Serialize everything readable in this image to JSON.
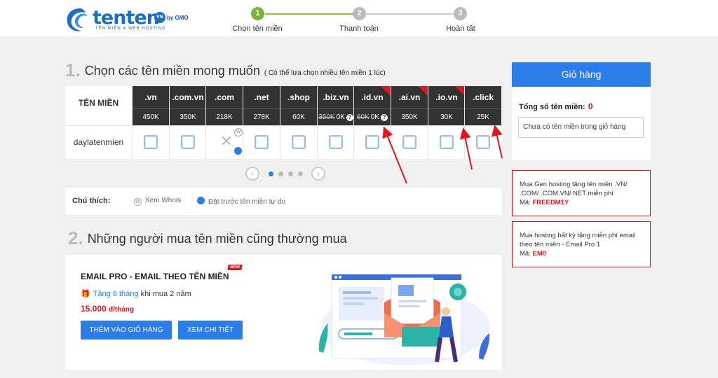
{
  "logo": {
    "brand": "tenten",
    "vn_badge": "VN",
    "gmo": "by GMO",
    "tagline": "TÊN MIỀN & WEB HOSTING"
  },
  "steps": [
    {
      "num": "1",
      "label": "Chọn tên miền",
      "active": true
    },
    {
      "num": "2",
      "label": "Thanh toán",
      "active": false
    },
    {
      "num": "3",
      "label": "Hoàn tất",
      "active": false
    }
  ],
  "section1": {
    "num": "1.",
    "title": "Chọn các tên miền mong muốn",
    "note": "( Có thể lựa chọn nhiều tên miền 1 lúc)"
  },
  "domain_table": {
    "header_label": "TÊN MIỀN",
    "domain_name": "daylatenmien",
    "extensions": [
      {
        "ext": ".vn",
        "price": "450K",
        "old_price": "",
        "new": false,
        "available": true
      },
      {
        "ext": ".com.vn",
        "price": "350K",
        "old_price": "",
        "new": false,
        "available": true
      },
      {
        "ext": ".com",
        "price": "218K",
        "old_price": "",
        "new": false,
        "available": false
      },
      {
        "ext": ".net",
        "price": "278K",
        "old_price": "",
        "new": false,
        "available": true
      },
      {
        "ext": ".shop",
        "price": "60K",
        "old_price": "",
        "new": false,
        "available": true
      },
      {
        "ext": ".biz.vn",
        "price": "0K",
        "old_price": "350K",
        "new": false,
        "available": true
      },
      {
        "ext": ".id.vn",
        "price": "0K",
        "old_price": "60K",
        "new": true,
        "available": true
      },
      {
        "ext": ".ai.vn",
        "price": "350K",
        "old_price": "",
        "new": true,
        "available": true
      },
      {
        "ext": ".io.vn",
        "price": "30K",
        "old_price": "",
        "new": true,
        "available": true
      },
      {
        "ext": ".click",
        "price": "25K",
        "old_price": "",
        "new": false,
        "available": true
      }
    ],
    "taken_mark": "✕",
    "whois_mark": "W"
  },
  "legend": {
    "title": "Chú thích:",
    "whois": "Xem Whois",
    "whois_icon": "W",
    "preorder": "Đặt trước tên miền tự do"
  },
  "pager": {
    "prev": "‹",
    "next": "›",
    "pages": 4,
    "active": 0
  },
  "section2": {
    "num": "2.",
    "title": "Những người mua tên miền cũng thường mua"
  },
  "product": {
    "title": "EMAIL PRO - EMAIL THEO TÊN MIỀN",
    "badge": "NEW",
    "gift_prefix": "Tặng 6 tháng",
    "gift_suffix": "khi mua 2 năm",
    "price": "15.000",
    "price_unit": "đ/tháng",
    "add_button": "THÊM VÀO GIỎ HÀNG",
    "detail_button": "XEM CHI TIẾT"
  },
  "cart": {
    "title": "Giỏ hàng",
    "count_label": "Tổng số tên miền:",
    "count": "0",
    "empty_text": "Chưa có tên miền trong giỏ hàng"
  },
  "promos": [
    {
      "text": "Mua Gen hosting tặng tên miền .VN/ .COM/ .COM.VN/.NET miễn phí",
      "code_label": "Mã:",
      "code": "FREEDM1Y"
    },
    {
      "text": "Mua hosting bất kỳ tặng miễn phí email theo tên miền - Email Pro 1",
      "code_label": "Mã:",
      "code": "EM0"
    }
  ],
  "colors": {
    "primary": "#2b7de9",
    "accent_red": "#d71920",
    "step_active": "#7cb23a",
    "table_header": "#333333"
  }
}
